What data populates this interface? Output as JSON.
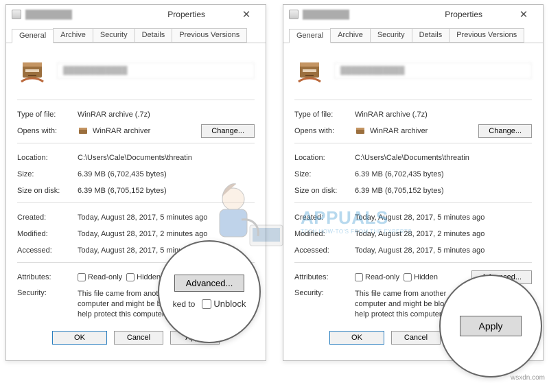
{
  "window": {
    "title_blur": "████████",
    "properties_label": "Properties",
    "close_glyph": "✕"
  },
  "tabs": {
    "general": "General",
    "archive": "Archive",
    "security": "Security",
    "details": "Details",
    "prev": "Previous Versions"
  },
  "header": {
    "filename_blur": "████████████"
  },
  "meta": {
    "type_label": "Type of file:",
    "type_value": "WinRAR archive (.7z)",
    "opens_label": "Opens with:",
    "opens_value": "WinRAR archiver",
    "change_btn": "Change...",
    "location_label": "Location:",
    "location_value": "C:\\Users\\Cale\\Documents\\threatin",
    "size_label": "Size:",
    "size_value": "6.39 MB (6,702,435 bytes)",
    "diskSize_label": "Size on disk:",
    "diskSize_value": "6.39 MB (6,705,152 bytes)",
    "created_label": "Created:",
    "created_value": "Today, August 28, 2017, 5 minutes ago",
    "modified_label": "Modified:",
    "modified_value": "Today, August 28, 2017, 2 minutes ago",
    "accessed_label": "Accessed:",
    "accessed_value": "Today, August 28, 2017, 5 minutes ago",
    "attributes_label": "Attributes:",
    "readonly_label": "Read-only",
    "hidden_label": "Hidden",
    "advanced_btn": "Advanced...",
    "security_label": "Security:",
    "security_text_left": "This file came from another computer and might be blocked to help protect this computer.",
    "security_text_right": "This file came from another computer and might be blocked to help protect this computer.",
    "unblock_label": "Unblock"
  },
  "buttons": {
    "ok": "OK",
    "cancel": "Cancel",
    "apply": "Apply"
  },
  "callout": {
    "unblock_label": "Unblock",
    "ked_to": "ked to"
  },
  "footer": "wsxdn.com",
  "watermark": {
    "brand": "APPUALS",
    "tagline": "TECH HOW-TO'S FROM THE EXPERTS"
  }
}
